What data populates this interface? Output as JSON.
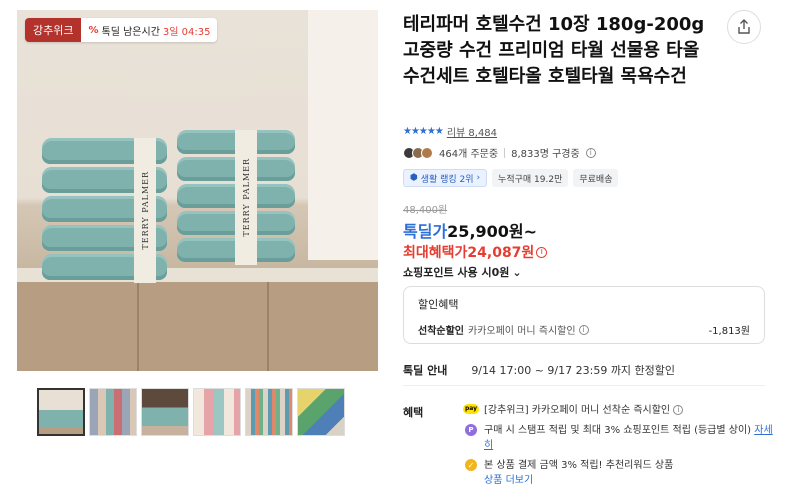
{
  "image_badge": {
    "week_label": "강추위크",
    "timer_label": "톡딜 남은시간",
    "timer_value": "3일 04:35"
  },
  "product_image": {
    "band_text": "TERRY PALMER"
  },
  "thumbnails": [
    "thumb-1",
    "thumb-2",
    "thumb-3",
    "thumb-4",
    "thumb-5",
    "thumb-6"
  ],
  "title": "테리파머 호텔수건 10장 180g-200g 고중량 수건 프리미엄 타월 선물용 타올 수건세트 호텔타올 호텔타월 목욕수건",
  "rating": {
    "stars": "★★★★★",
    "review_label": "리뷰 8,484"
  },
  "orders": {
    "orders_text": "464개 주문중",
    "subscribers_text": "8,833명 구경중"
  },
  "chips": {
    "rank": "생활 랭킹 2위",
    "cumulative": "누적구매 19.2만",
    "shipping": "무료배송"
  },
  "price": {
    "original": "48,400원",
    "deal_label": "톡딜가",
    "deal_value": "25,900원~",
    "max_benefit": "최대혜택가24,087원",
    "points_label": "쇼핑포인트 사용 시0원"
  },
  "discount": {
    "header": "할인혜택",
    "row_key": "선착순할인",
    "row_value": "카카오페이 머니 즉시할인",
    "row_amount": "-1,813원"
  },
  "deal_info": {
    "key": "톡딜 안내",
    "value": "9/14 17:00 ~ 9/17 23:59 까지 한정할인"
  },
  "benefits": {
    "key": "혜택",
    "item1": "[강추위크] 카카오페이 머니 선착순 즉시할인",
    "item2": "구매 시 스탬프 적립 및 최대 3% 쇼핑포인트 적립 (등급별 상이)",
    "item2_link": "자세히",
    "item3": "본 상품 결제 금액 3% 적립! 추천리워드 상품",
    "item3_link": "상품 더보기"
  },
  "colors": {
    "towel": "#7fb1ad",
    "badge_red": "#b3322c",
    "accent_blue": "#2d6fd6",
    "accent_red": "#e53d31"
  },
  "icons": [
    "share-icon",
    "info-icon",
    "chevron-down-icon",
    "kakaopay-icon",
    "point-icon",
    "coin-icon",
    "star-icon"
  ]
}
